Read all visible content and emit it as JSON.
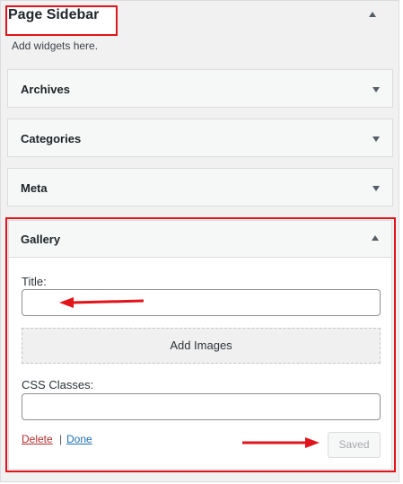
{
  "sidebar": {
    "title": "Page Sidebar",
    "description": "Add widgets here."
  },
  "widgets": [
    {
      "label": "Archives"
    },
    {
      "label": "Categories"
    },
    {
      "label": "Meta"
    }
  ],
  "gallery": {
    "label": "Gallery",
    "title_label": "Title:",
    "title_value": "",
    "add_images_label": "Add Images",
    "css_label": "CSS Classes:",
    "css_value": "",
    "delete_label": "Delete",
    "separator": "|",
    "done_label": "Done",
    "saved_label": "Saved"
  },
  "colors": {
    "annotation": "#e2141b",
    "delete_link": "#b32d2e",
    "done_link": "#2271b1"
  }
}
